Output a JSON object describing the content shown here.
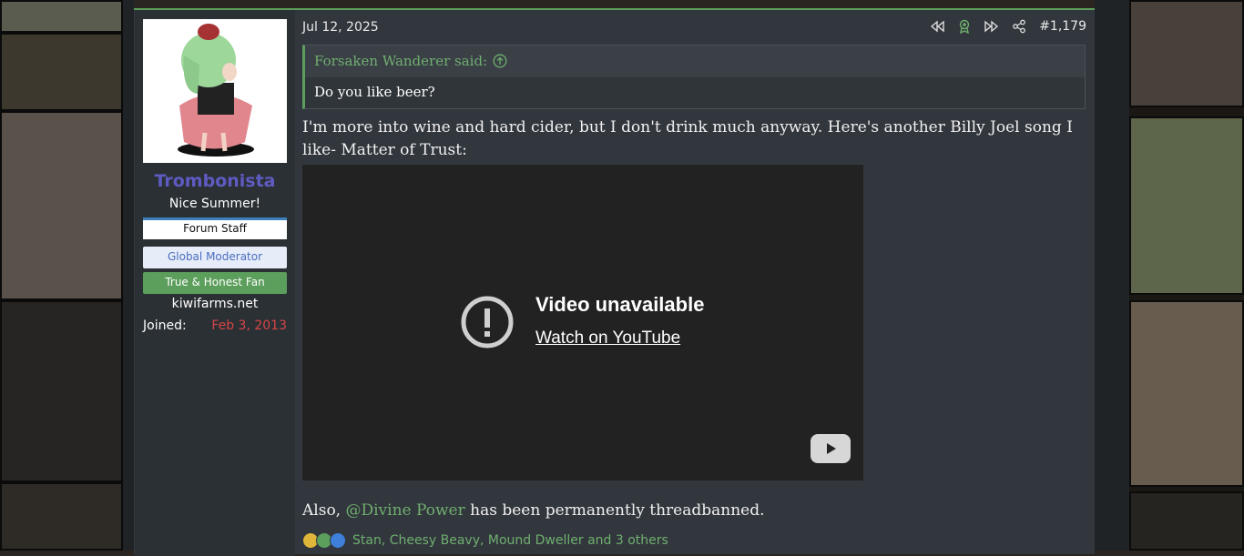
{
  "post": {
    "date": "Jul 12, 2025",
    "number": "#1,179",
    "user": {
      "name": "Trombonista",
      "title": "Nice Summer!",
      "banners": [
        "Forum Staff",
        "Global Moderator",
        "True & Honest Fan"
      ],
      "site": "kiwifarms.net",
      "joined_label": "Joined:",
      "joined_value": "Feb 3, 2013"
    },
    "quote": {
      "author": "Forsaken Wanderer said:",
      "text": "Do you like beer?"
    },
    "message": "I'm more into wine and hard cider, but I don't drink much anyway. Here's another Billy Joel song I like- Matter of Trust:",
    "video": {
      "title": "Video unavailable",
      "link": "Watch on YouTube"
    },
    "footer": {
      "prefix": "Also, ",
      "mention": "@Divine Power",
      "suffix": " has been permanently threadbanned."
    },
    "reactions": {
      "icons": [
        "winner-icon",
        "cocktail-icon",
        "like-icon"
      ],
      "text": "Stan, Cheesy Beavy, Mound Dweller and 3 others"
    }
  },
  "colors": {
    "accent": "#5c9e5c",
    "username": "#5e5bc2",
    "joined_date": "#d64545",
    "background": "#32373d"
  }
}
